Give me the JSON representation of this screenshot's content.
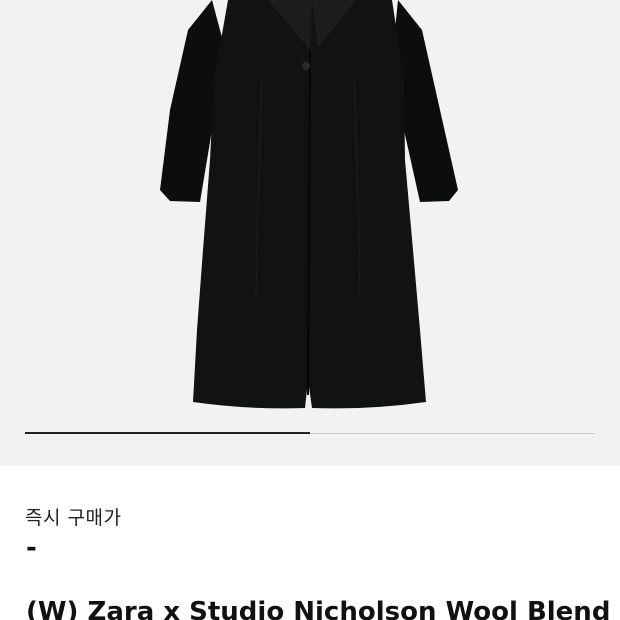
{
  "product": {
    "image_alt": "black wool coat",
    "carousel_progress": 0.5
  },
  "price": {
    "label": "즉시 구매가",
    "value": "-"
  },
  "title": "(W) Zara x Studio Nicholson Wool Blend"
}
